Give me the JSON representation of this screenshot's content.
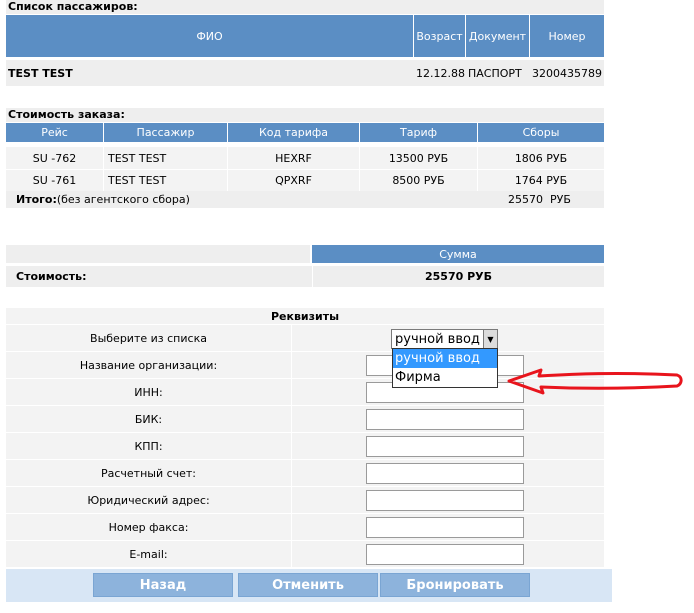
{
  "passengers": {
    "title": "Список пассажиров:",
    "headers": [
      "ФИО",
      "Возраст",
      "Документ",
      "Номер"
    ],
    "rows": [
      {
        "name": "TEST TEST",
        "birth": "12.12.88",
        "doc": "ПАСПОРТ",
        "number": "3200435789"
      }
    ]
  },
  "order_cost": {
    "title": "Стоимость заказа:",
    "headers": [
      "Рейс",
      "Пассажир",
      "Код тарифа",
      "Тариф",
      "Сборы"
    ],
    "rows": [
      {
        "flight": "SU -762",
        "passenger": "TEST TEST",
        "code": "HEXRF",
        "tariff": "13500 РУБ",
        "fees": "1806 РУБ"
      },
      {
        "flight": "SU -761",
        "passenger": "TEST TEST",
        "code": "QPXRF",
        "tariff": "8500 РУБ",
        "fees": "1764 РУБ"
      }
    ],
    "total_label": "Итого:",
    "total_note": "(без агентского сбора)",
    "total_value": "25570  РУБ"
  },
  "summary": {
    "sum_header": "Сумма",
    "cost_label": "Стоимость:",
    "cost_value": "25570 РУБ"
  },
  "requisites": {
    "title": "Реквизиты",
    "select_label": "Выберите из списка",
    "select_value": "ручной ввод",
    "dropdown_options": [
      "ручной ввод",
      "Фирма"
    ],
    "fields": [
      {
        "label": "Название организации:",
        "value": ""
      },
      {
        "label": "ИНН:",
        "value": ""
      },
      {
        "label": "БИК:",
        "value": ""
      },
      {
        "label": "КПП:",
        "value": ""
      },
      {
        "label": "Расчетный счет:",
        "value": ""
      },
      {
        "label": "Юридический адрес:",
        "value": ""
      },
      {
        "label": "Номер факса:",
        "value": ""
      },
      {
        "label": "E-mail:",
        "value": ""
      }
    ]
  },
  "buttons": {
    "back": "Назад",
    "cancel": "Отменить",
    "book": "Бронировать"
  },
  "colors": {
    "header_blue": "#5b8ec4",
    "button_blue": "#8db3dc",
    "arrow_red": "#e8141c",
    "dropdown_highlight": "#3399ff"
  }
}
